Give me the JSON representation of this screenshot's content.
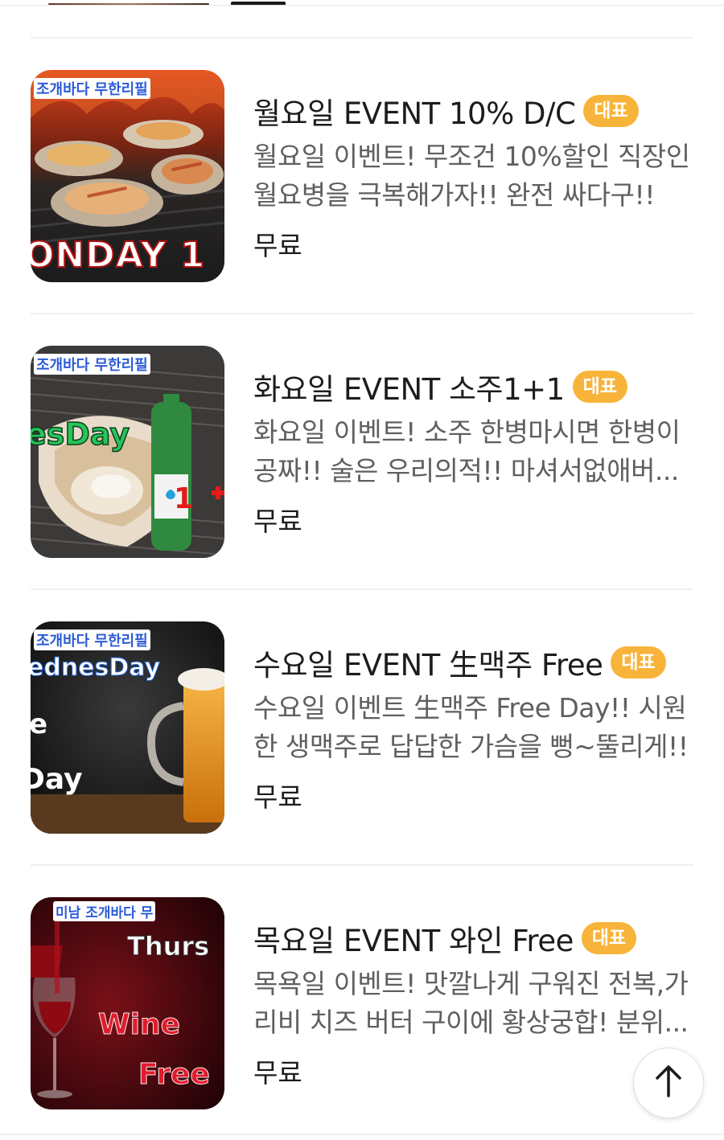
{
  "colors": {
    "badge_bg": "#f8b43a",
    "title_text": "#1c1c1c",
    "desc_text": "#5f5f5f",
    "divider": "#f0f0f0"
  },
  "menu_items": [
    {
      "title": "월요일 EVENT 10% D/C",
      "badge": "대표",
      "description": "월요일 이벤트! 무조건 10%할인 직장인 월요병을 극복해가자!! 완전 싸다구!!",
      "price": "무료",
      "image_brand": "조개바다 무한리필",
      "image_caption": "ONDAY 1"
    },
    {
      "title": "화요일 EVENT 소주1+1",
      "badge": "대표",
      "description": "화요일 이벤트! 소주 한병마시면 한병이 공짜!! 술은 우리의적!! 마셔서없애버...",
      "price": "무료",
      "image_brand": "조개바다 무한리필",
      "image_caption": "esDay",
      "image_badge": "1"
    },
    {
      "title": "수요일 EVENT 生맥주 Free",
      "badge": "대표",
      "description": "수요일 이벤트 生맥주 Free Day!! 시원한 생맥주로 답답한 가슴을 뻥~뚤리게!!",
      "price": "무료",
      "image_brand": "조개바다 무한리필",
      "image_caption": "ednesDay",
      "image_line2": "e",
      "image_line3": "Day"
    },
    {
      "title": "목요일 EVENT 와인 Free",
      "badge": "대표",
      "description": "목욕일 이벤트! 맛깔나게 구워진 전복,가리비 치즈 버터 구이에 황상궁합! 분위...",
      "price": "무료",
      "image_brand": "미남 조개바다 무",
      "image_caption": "Thurs",
      "image_line2": "Wine",
      "image_line3": "Free"
    }
  ],
  "scroll_top": {
    "icon": "arrow-up-icon"
  }
}
